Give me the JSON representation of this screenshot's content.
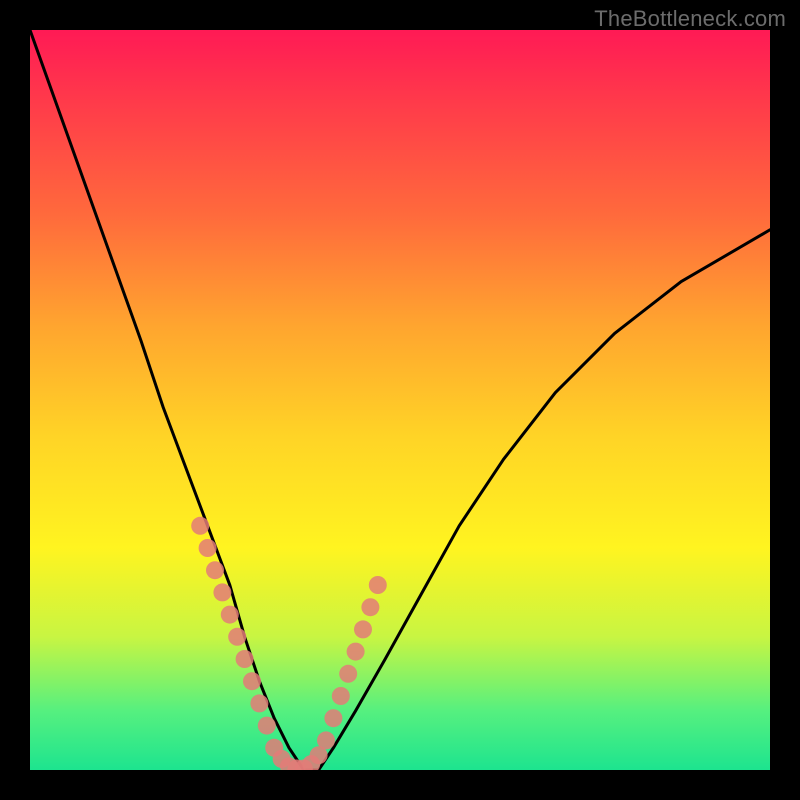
{
  "watermark": "TheBottleneck.com",
  "colors": {
    "background": "#000000",
    "curve": "#000000",
    "dots": "#e37b78",
    "watermark": "#6c6c6c"
  },
  "chart_data": {
    "type": "line",
    "title": "",
    "xlabel": "",
    "ylabel": "",
    "xlim": [
      0,
      100
    ],
    "ylim": [
      0,
      100
    ],
    "series": [
      {
        "name": "bottleneck-curve",
        "x": [
          0,
          5,
          10,
          15,
          18,
          21,
          24,
          27,
          29,
          31,
          33,
          35,
          37,
          39,
          41,
          44,
          48,
          53,
          58,
          64,
          71,
          79,
          88,
          100
        ],
        "y": [
          100,
          86,
          72,
          58,
          49,
          41,
          33,
          25,
          18,
          12,
          7,
          3,
          0,
          0,
          3,
          8,
          15,
          24,
          33,
          42,
          51,
          59,
          66,
          73
        ]
      }
    ],
    "highlight_dots": {
      "name": "highlight-dots",
      "x": [
        23,
        24,
        25,
        26,
        27,
        28,
        29,
        30,
        31,
        32,
        33,
        34,
        35,
        36,
        37,
        38,
        39,
        40,
        41,
        42,
        43,
        44,
        45,
        46,
        47
      ],
      "y": [
        33,
        30,
        27,
        24,
        21,
        18,
        15,
        12,
        9,
        6,
        3,
        1.5,
        0.5,
        0.2,
        0.2,
        0.8,
        2,
        4,
        7,
        10,
        13,
        16,
        19,
        22,
        25
      ]
    }
  }
}
